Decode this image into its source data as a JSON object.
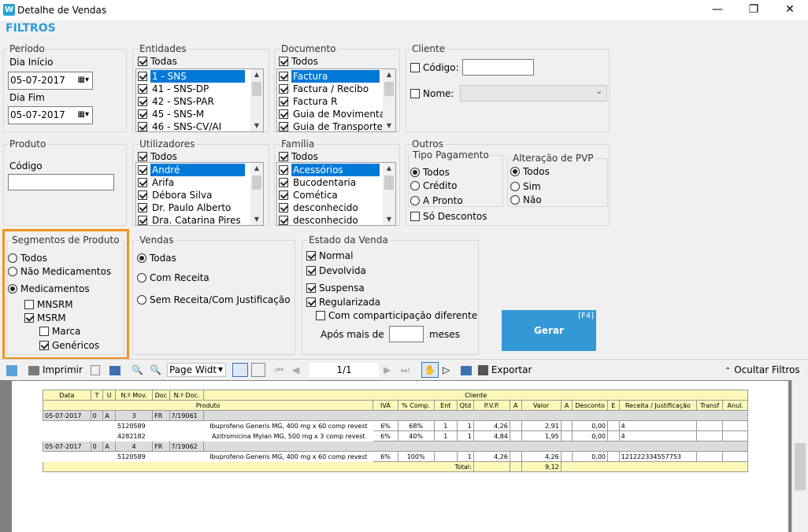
{
  "window": {
    "icon": "W",
    "title": "Detalhe de Vendas",
    "controls": [
      "minimize-icon",
      "restore-icon",
      "close-icon"
    ]
  },
  "header": "FILTROS",
  "periodo": {
    "label": "Período",
    "inicio_label": "Dia Início",
    "inicio": "05-07-2017",
    "fim_label": "Dia Fim",
    "fim": "05-07-2017"
  },
  "entidades": {
    "label": "Entidades",
    "todas": "Todas",
    "items": [
      "1 - SNS",
      "41 - SNS-DP",
      "42 - SNS-PAR",
      "45 - SNS-M",
      "46 - SNS-CV/AI"
    ]
  },
  "documento": {
    "label": "Documento",
    "todas": "Todos",
    "items": [
      "Factura",
      "Factura / Recibo",
      "Factura R",
      "Guia de Movimentaç",
      "Guia de Transporte"
    ]
  },
  "cliente": {
    "label": "Cliente",
    "codigo": "Código:",
    "nome": "Nome:"
  },
  "produto": {
    "label": "Produto",
    "codigo": "Código"
  },
  "utilizadores": {
    "label": "Utilizadores",
    "todas": "Todos",
    "items": [
      "André",
      "Arifa",
      "Débora Silva",
      "Dr. Paulo Alberto",
      "Dra. Catarina Pires"
    ]
  },
  "familia": {
    "label": "Família",
    "todas": "Todos",
    "items": [
      "Acessórios",
      "Bucodentaria",
      "Comética",
      "desconhecido",
      "desconhecido"
    ]
  },
  "outros": {
    "label": "Outros",
    "tipo_pag": {
      "label": "Tipo Pagamento",
      "options": [
        "Todos",
        "Crédito",
        "A Pronto"
      ]
    },
    "pvp": {
      "label": "Alteração de PVP",
      "options": [
        "Todos",
        "Sim",
        "Não"
      ]
    },
    "so_descontos": "Só Descontos"
  },
  "segmentos": {
    "label": "Segmentos de Produto",
    "todos": "Todos",
    "nao_med": "Não Medicamentos",
    "med": "Medicamentos",
    "mnsrm": "MNSRM",
    "msrm": "MSRM",
    "marca": "Marca",
    "genericos": "Genéricos"
  },
  "vendas": {
    "label": "Vendas",
    "options": [
      "Todas",
      "Com Receita",
      "Sem Receita/Com Justificação"
    ]
  },
  "estado": {
    "label": "Estado da Venda",
    "normal": "Normal",
    "devolvida": "Devolvida",
    "suspensa": "Suspensa",
    "regularizada": "Regularizada",
    "compart": "Com comparticipação diferente",
    "apos": "Após mais de",
    "meses": "meses"
  },
  "gerar": {
    "label": "Gerar",
    "shortcut": "[F4]"
  },
  "toolbar": {
    "imprimir": "Imprimir",
    "zoom": "Page Widt",
    "page": "1/1",
    "exportar": "Exportar",
    "ocultar": "Ocultar Filtros"
  },
  "report": {
    "h1": [
      "Data",
      "T",
      "U",
      "N.º Mov.",
      "Doc",
      "N.º Doc.",
      "Cliente"
    ],
    "h2": [
      "Produto",
      "IVA",
      "% Comp.",
      "Ent",
      "Qtd",
      "P.V.P.",
      "A",
      "Valor",
      "A",
      "Desconto",
      "E",
      "Receita / Justificação",
      "Transf",
      "Anul."
    ],
    "g1": {
      "data": "05-07-2017",
      "t": "0",
      "u": "A",
      "mov": "3",
      "doc": "FR",
      "ndoc": "7/19061"
    },
    "r1": {
      "cod": "5120589",
      "prod": "Ibuprofeno Generis MG, 400 mg x 60 comp revest",
      "iva": "6%",
      "comp": "68%",
      "ent": "1",
      "qtd": "1",
      "pvp": "4,26",
      "valor": "2,91",
      "desc": "0,00",
      "e": "4"
    },
    "r2": {
      "cod": "4282182",
      "prod": "Azitromicina Mylan MG, 500 mg x 3 comp revest",
      "iva": "6%",
      "comp": "40%",
      "ent": "1",
      "qtd": "1",
      "pvp": "4,84",
      "valor": "1,95",
      "desc": "0,00",
      "e": "4"
    },
    "g2": {
      "data": "05-07-2017",
      "t": "0",
      "u": "A",
      "mov": "4",
      "doc": "FR",
      "ndoc": "7/19062"
    },
    "r3": {
      "cod": "5120589",
      "prod": "Ibuprofeno Generis MG, 400 mg x 60 comp revest",
      "iva": "6%",
      "comp": "100%",
      "qtd": "1",
      "pvp": "4,26",
      "valor": "4,26",
      "desc": "0,00",
      "rec": "121222334557753"
    },
    "total_label": "Total:",
    "total": "9,12"
  }
}
